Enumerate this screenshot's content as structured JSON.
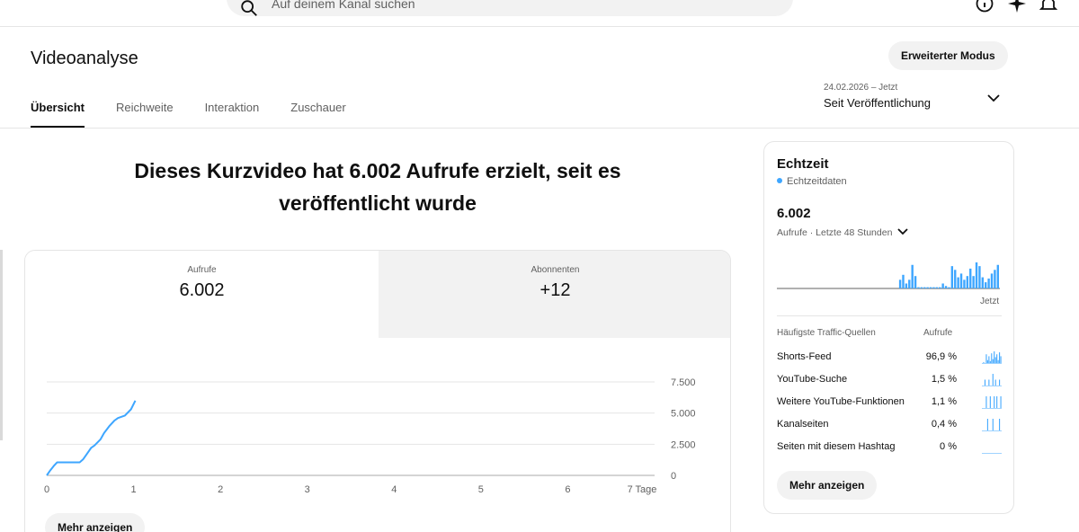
{
  "search": {
    "placeholder": "Auf deinem Kanal suchen"
  },
  "header": {
    "title": "Videoanalyse",
    "advanced_mode": "Erweiterter Modus",
    "tabs": [
      "Übersicht",
      "Reichweite",
      "Interaktion",
      "Zuschauer"
    ],
    "date_range": "24.02.2026 – Jetzt",
    "period": "Seit Veröffentlichung"
  },
  "headline": "Dieses Kurzvideo hat 6.002 Aufrufe erzielt, seit es veröffentlicht wurde",
  "metrics": [
    {
      "label": "Aufrufe",
      "value": "6.002"
    },
    {
      "label": "Abonnenten",
      "value": "+12"
    }
  ],
  "chart_data": {
    "type": "line",
    "x_unit_label": "7 Tage",
    "x_ticks": [
      "0",
      "1",
      "2",
      "3",
      "4",
      "5",
      "6",
      "7 Tage"
    ],
    "y_ticks": [
      "0",
      "2.500",
      "5.000",
      "7.500"
    ],
    "xlim": [
      0,
      7
    ],
    "ylim": [
      0,
      7500
    ],
    "series": [
      {
        "x": [
          0,
          0.04,
          0.08,
          0.12,
          0.3,
          0.38,
          0.42,
          0.47,
          0.51,
          0.55,
          0.62,
          0.66,
          0.72,
          0.78,
          0.82,
          0.86,
          0.9,
          0.97,
          1.02
        ],
        "y": [
          0,
          400,
          750,
          1050,
          1050,
          1050,
          1300,
          1800,
          2200,
          2400,
          2900,
          3400,
          3950,
          4400,
          4600,
          4700,
          4800,
          5300,
          6002
        ]
      }
    ],
    "color": "#3ea6ff"
  },
  "more_label": "Mehr anzeigen",
  "realtime": {
    "title": "Echtzeit",
    "subtitle": "Echtzeitdaten",
    "value": "6.002",
    "period": "Aufrufe · Letzte 48 Stunden",
    "now_label": "Jetzt",
    "bars": [
      0,
      0,
      0,
      0,
      0,
      0,
      0,
      0,
      0,
      0,
      0,
      0,
      0,
      0,
      0,
      0,
      0,
      0,
      0,
      0,
      0,
      0,
      0,
      0,
      0,
      0,
      0,
      0,
      0,
      0,
      0,
      0,
      0,
      0,
      0,
      0,
      0,
      0,
      0,
      0,
      7,
      11,
      4,
      7,
      19,
      10,
      1,
      1,
      1,
      1,
      1,
      1,
      1,
      1,
      4,
      2,
      1,
      18,
      15,
      9,
      12,
      7,
      10,
      16,
      10,
      21,
      18,
      9,
      5,
      8,
      12,
      15,
      19
    ],
    "bar_color": "#3ea6ff",
    "sources_header": "Häufigste Traffic-Quellen",
    "views_header": "Aufrufe",
    "sources": [
      {
        "name": "Shorts-Feed",
        "percent": "96,9 %",
        "spark": [
          0,
          1,
          0,
          9,
          3,
          7,
          2,
          10,
          4,
          12,
          6,
          9,
          3,
          11,
          7
        ]
      },
      {
        "name": "YouTube-Suche",
        "percent": "1,5 %",
        "spark": [
          0,
          0,
          1,
          0,
          0,
          1,
          0,
          0,
          2,
          0,
          1,
          0,
          0,
          1,
          0
        ]
      },
      {
        "name": "Weitere YouTube-Funktionen",
        "percent": "1,1 %",
        "spark": [
          0,
          0,
          0,
          1,
          0,
          0,
          1,
          0,
          0,
          1,
          0,
          1,
          0,
          0,
          1
        ]
      },
      {
        "name": "Kanalseiten",
        "percent": "0,4 %",
        "spark": [
          0,
          0,
          0,
          0,
          1,
          0,
          0,
          0,
          1,
          0,
          0,
          0,
          0,
          1,
          0
        ]
      },
      {
        "name": "Seiten mit diesem Hashtag",
        "percent": "0 %",
        "spark": [
          0,
          0,
          0,
          0,
          0,
          0,
          0,
          0,
          0,
          0,
          0,
          0,
          0,
          0,
          0
        ]
      }
    ]
  }
}
